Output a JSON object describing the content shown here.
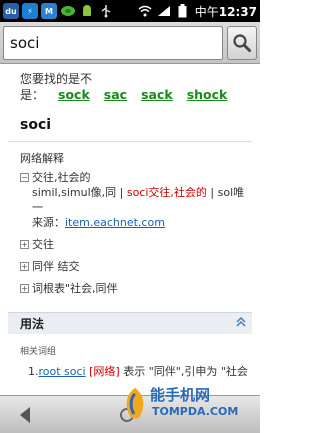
{
  "status_bar": {
    "apps": [
      {
        "icon": "dict-app-icon",
        "label": "du",
        "color": "#2a5ea8"
      },
      {
        "icon": "lightning-app-icon",
        "label": "⚡",
        "color": "#1d7fd1"
      },
      {
        "icon": "maxthon-app-icon",
        "label": "M",
        "color": "#2b80d0"
      },
      {
        "icon": "leaf-app-icon",
        "label": "",
        "color": "#3aa33a"
      },
      {
        "icon": "android-icon",
        "label": "",
        "color": "#000000"
      },
      {
        "icon": "usb-icon",
        "label": "",
        "color": "#000000"
      }
    ],
    "time_prefix": "中午",
    "time": "12:37"
  },
  "search": {
    "query": "soci"
  },
  "suggestions": {
    "prompt_line1": "您要找的是不",
    "prompt_line2": "是：",
    "items": [
      "sock",
      "sac",
      "sack",
      "shock"
    ]
  },
  "headword": "soci",
  "web_section": {
    "title": "网络解释",
    "expanded": {
      "term": "交往,社会的",
      "text_plain": "simil,simul像,同 | ",
      "text_red": "soci交往,社会的",
      "text_after": " | sol唯一",
      "source_label": "来源：",
      "source_link": "item.eachnet.com"
    },
    "collapsed": [
      "交往",
      "同伴 结交",
      "词根表\"社会,同伴"
    ]
  },
  "usage": {
    "title": "用法",
    "related_label": "相关词组",
    "item_number": "1.",
    "item_link": "root soci",
    "item_tag": "[网络]",
    "item_text": " 表示 \"同伴\",引申为 \"社会"
  },
  "watermark": {
    "cn": "能手机网",
    "en": "TOMPDA.COM"
  },
  "colors": {
    "suggest_link": "#1a8a1a",
    "link": "#1a5fb4",
    "highlight": "#cc0000"
  }
}
